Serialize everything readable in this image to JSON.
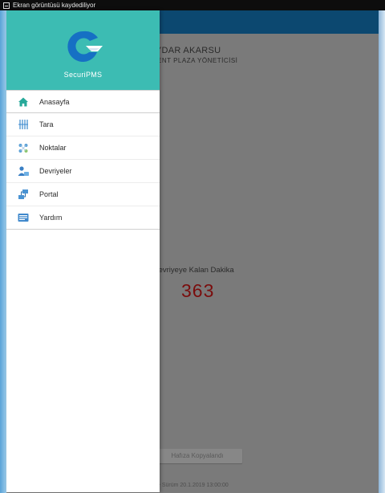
{
  "status_bar": {
    "text": "Ekran görüntüsü kaydediliyor"
  },
  "background": {
    "user_name": "AYDAR AKARSU",
    "user_role": "ENT PLAZA YÖNETİCİSİ",
    "countdown_label": "i Devriyeye Kalan Dakika",
    "countdown_value": "363",
    "button_label": "Hafıza Kopyalandı",
    "footer_text": "e Sürüm 20.1.2019 13:00:00"
  },
  "drawer": {
    "brand": "SecuriPMS",
    "items": [
      {
        "label": "Anasayfa",
        "icon": "home-icon"
      },
      {
        "label": "Tara",
        "icon": "scan-icon"
      },
      {
        "label": "Noktalar",
        "icon": "points-icon"
      },
      {
        "label": "Devriyeler",
        "icon": "patrols-icon"
      },
      {
        "label": "Portal",
        "icon": "portal-icon"
      },
      {
        "label": "Yardım",
        "icon": "help-icon"
      }
    ]
  },
  "colors": {
    "drawer_header": "#3cbcb3",
    "toolbar": "#0c4870",
    "counter": "#7a0d0d",
    "logo_blue": "#1670c4"
  }
}
